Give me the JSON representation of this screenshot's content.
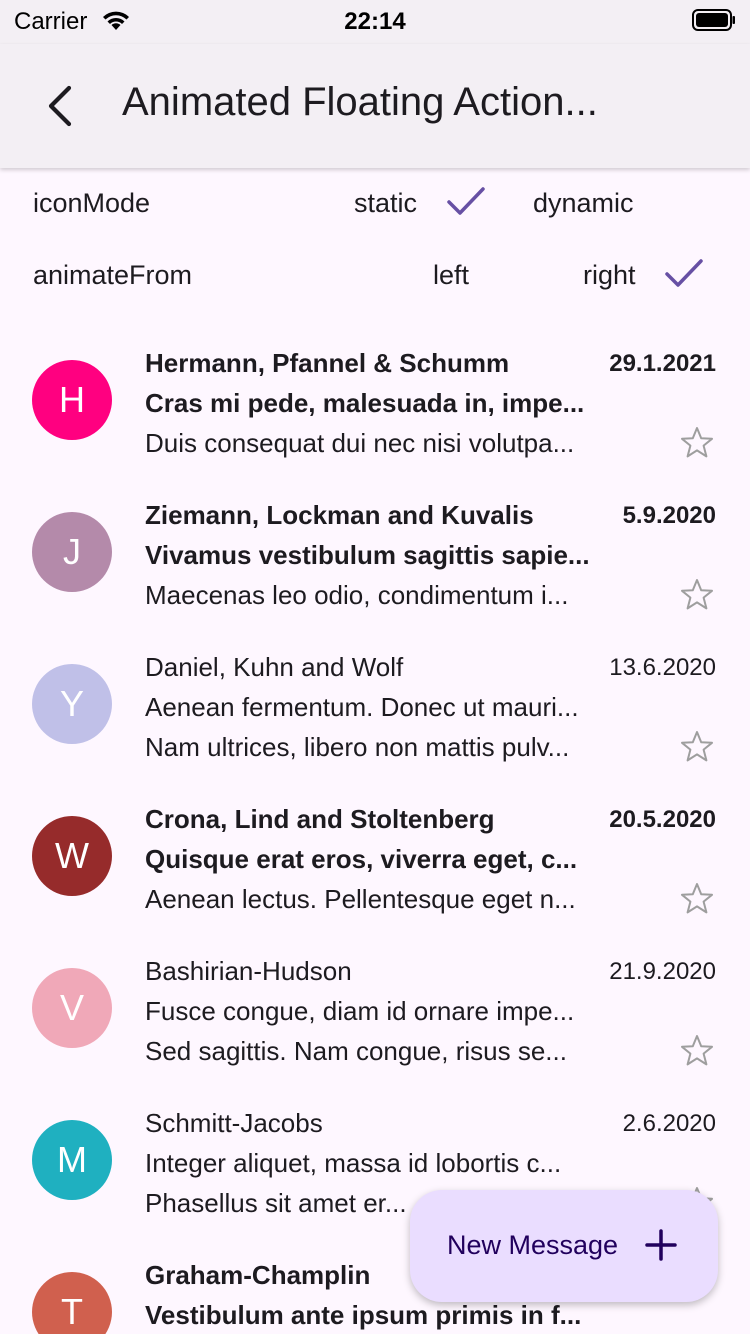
{
  "status_bar": {
    "carrier": "Carrier",
    "time": "22:14"
  },
  "app_bar": {
    "title": "Animated Floating Action..."
  },
  "options": {
    "icon_mode": {
      "label": "iconMode",
      "choices": [
        "static",
        "dynamic"
      ],
      "selected": "static"
    },
    "animate_from": {
      "label": "animateFrom",
      "choices": [
        "left",
        "right"
      ],
      "selected": "right"
    }
  },
  "messages": [
    {
      "initial": "H",
      "color": "#ff0080",
      "sender": "Hermann, Pfannel & Schumm",
      "date": "29.1.2021",
      "subject": "Cras mi pede, malesuada in, impe...",
      "preview": "Duis consequat dui nec nisi volutpa...",
      "unread": true
    },
    {
      "initial": "J",
      "color": "#b48aaa",
      "sender": "Ziemann, Lockman and Kuvalis",
      "date": "5.9.2020",
      "subject": "Vivamus vestibulum sagittis sapie...",
      "preview": "Maecenas leo odio, condimentum i...",
      "unread": true
    },
    {
      "initial": "Y",
      "color": "#c0c0e8",
      "sender": "Daniel, Kuhn and Wolf",
      "date": "13.6.2020",
      "subject": "Aenean fermentum. Donec ut mauri...",
      "preview": "Nam ultrices, libero non mattis pulv...",
      "unread": false
    },
    {
      "initial": "W",
      "color": "#962b2b",
      "sender": "Crona, Lind and Stoltenberg",
      "date": "20.5.2020",
      "subject": "Quisque erat eros, viverra eget, c...",
      "preview": "Aenean lectus. Pellentesque eget n...",
      "unread": true
    },
    {
      "initial": "V",
      "color": "#f0a8b8",
      "sender": "Bashirian-Hudson",
      "date": "21.9.2020",
      "subject": "Fusce congue, diam id ornare impe...",
      "preview": "Sed sagittis. Nam congue, risus se...",
      "unread": false
    },
    {
      "initial": "M",
      "color": "#1fb0c0",
      "sender": "Schmitt-Jacobs",
      "date": "2.6.2020",
      "subject": "Integer aliquet, massa id lobortis c...",
      "preview": "Phasellus sit amet er...",
      "unread": false
    },
    {
      "initial": "T",
      "color": "#d0604e",
      "sender": "Graham-Champlin",
      "date": "",
      "subject": "Vestibulum ante ipsum primis in f...",
      "preview": "",
      "unread": true
    }
  ],
  "fab": {
    "label": "New Message"
  },
  "colors": {
    "accent": "#6750a4",
    "surface": "#fef7ff",
    "app_bar": "#f3eff4",
    "fab": "#eaddff",
    "fab_text": "#21005d"
  }
}
